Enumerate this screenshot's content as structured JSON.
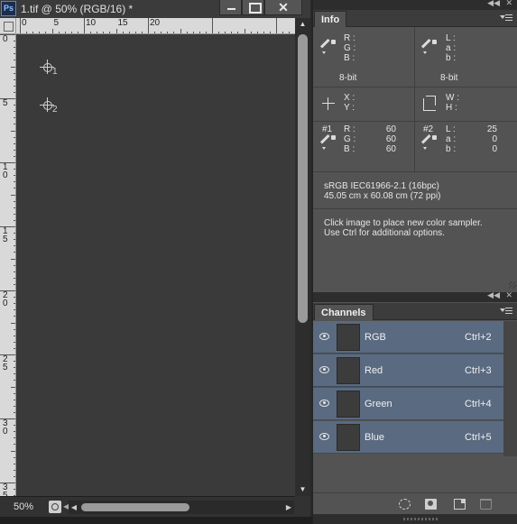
{
  "document": {
    "title": "1.tif @ 50% (RGB/16) *",
    "app_icon": "Ps",
    "close_label": "✕",
    "ruler_top_labels": [
      "0",
      "5",
      "10",
      "15",
      "20"
    ],
    "ruler_left_labels": [
      "0",
      "5",
      "10",
      "15",
      "20",
      "25",
      "30",
      "35"
    ],
    "samplers": [
      {
        "id": "1",
        "icon": "color-sampler-icon"
      },
      {
        "id": "2",
        "icon": "color-sampler-icon"
      }
    ],
    "zoom": "50%"
  },
  "info_panel": {
    "tab_label": "Info",
    "collapse_label": "◀◀",
    "close_label": "✕",
    "rgb_labels": [
      "R :",
      "G :",
      "B :"
    ],
    "lab_labels": [
      "L :",
      "a :",
      "b :"
    ],
    "bit_left": "8-bit",
    "bit_right": "8-bit",
    "xy_labels": [
      "X :",
      "Y :"
    ],
    "wh_labels": [
      "W :",
      "H :"
    ],
    "sampler1": {
      "id": "#1",
      "labels": [
        "R :",
        "G :",
        "B :"
      ],
      "values": [
        "60",
        "60",
        "60"
      ]
    },
    "sampler2": {
      "id": "#2",
      "labels": [
        "L :",
        "a :",
        "b :"
      ],
      "values": [
        "25",
        "0",
        "0"
      ]
    },
    "profile": "sRGB IEC61966-2.1 (16bpc)",
    "doc_size": "45.05 cm x 60.08 cm (72 ppi)",
    "hint_line1": "Click image to place new color sampler.",
    "hint_line2": "Use Ctrl for additional options."
  },
  "channels_panel": {
    "tab_label": "Channels",
    "collapse_label": "◀◀",
    "close_label": "✕",
    "channels": [
      {
        "name": "RGB",
        "shortcut": "Ctrl+2"
      },
      {
        "name": "Red",
        "shortcut": "Ctrl+3"
      },
      {
        "name": "Green",
        "shortcut": "Ctrl+4"
      },
      {
        "name": "Blue",
        "shortcut": "Ctrl+5"
      }
    ]
  }
}
